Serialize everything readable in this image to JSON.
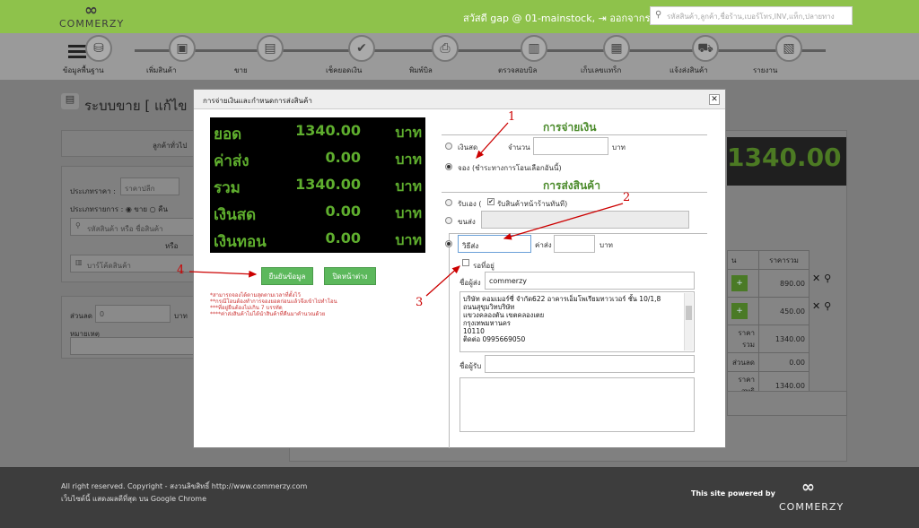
{
  "header": {
    "logo_text": "COMMERZY",
    "greeting": "สวัสดี gap @ 01-mainstock,",
    "logout": "ออกจากระบบ",
    "search_placeholder": "รหัสสินค้า,ลูกค้า,ชื่อร้าน,เบอร์โทร,INV,แท็ก,ปลายทาง"
  },
  "nav": {
    "items": [
      {
        "label": "ข้อมูลพื้นฐาน",
        "icon": "database-icon",
        "glyph": "⛁"
      },
      {
        "label": "เพิ่มสินค้า",
        "icon": "box-icon",
        "glyph": "▣"
      },
      {
        "label": "ขาย",
        "icon": "register-icon",
        "glyph": "▤"
      },
      {
        "label": "เช็คยอดเงิน",
        "icon": "check-icon",
        "glyph": "✔"
      },
      {
        "label": "พิมพ์บิล",
        "icon": "printer-icon",
        "glyph": "⎙"
      },
      {
        "label": "ตรวจสอบบิล",
        "icon": "scanner-icon",
        "glyph": "▥"
      },
      {
        "label": "เก็บเลขแทร็ก",
        "icon": "tracking-icon",
        "glyph": "▦"
      },
      {
        "label": "แจ้งส่งสินค้า",
        "icon": "truck-icon",
        "glyph": "⛟"
      },
      {
        "label": "รายงาน",
        "icon": "report-icon",
        "glyph": "▧"
      }
    ]
  },
  "page": {
    "title": "ระบบขาย [ แก้ไข",
    "customer": "ลูกค้าทั่วไป",
    "price_type_label": "ประเภทราคา :",
    "price_type": "ราคาปลีก",
    "trans_type_label": "ประเภทรายการ :",
    "trans_sell": "ขาย",
    "trans_return": "คืน",
    "product_search_placeholder": "รหัสสินค้า หรือ ชื่อสินค้า",
    "or": "หรือ",
    "barcode_placeholder": "บาร์โค้ดสินค้า",
    "discount_label": "ส่วนลด",
    "discount_value": "0",
    "discount_unit": "บาท",
    "remark_label": "หมายเหตุ",
    "big_total": "1340.00",
    "table_header": "ราคารวม",
    "table_header_left": "น",
    "rows": [
      "890.00",
      "450.00"
    ],
    "summary_rows": [
      {
        "label": "ราคารวม",
        "value": "1340.00"
      },
      {
        "label": "ส่วนลด",
        "value": "0.00"
      },
      {
        "label": "ราคาสุทธิ",
        "value": "1340.00"
      }
    ]
  },
  "modal": {
    "title": "การจ่ายเงินและกำหนดการส่งสินค้า",
    "summary": [
      {
        "label": "ยอด",
        "value": "1340.00",
        "unit": "บาท"
      },
      {
        "label": "ค่าส่ง",
        "value": "0.00",
        "unit": "บาท"
      },
      {
        "label": "รวม",
        "value": "1340.00",
        "unit": "บาท"
      },
      {
        "label": "เงินสด",
        "value": "0.00",
        "unit": "บาท"
      },
      {
        "label": "เงินทอน",
        "value": "0.00",
        "unit": "บาท"
      }
    ],
    "confirm_button": "ยืนยันข้อมูล",
    "close_button": "ปิดหน้าต่าง",
    "notes": [
      "*สามารถจองได้ตามสุดตามเวลาที่ตั้งไว้",
      "**กรณีโอนต้องทำการจองยอดก่อนแล้วจึงเข้าไปทำโอน",
      "***ที่อยู่ยืนต้องไม่เกิน 7 บรรทัด",
      "****ค่าส่งสินค้าไม่ได้นำสินค้าที่คืนมาคำนวณด้วย"
    ],
    "payment_header": "การจ่ายเงิน",
    "pay_cash": "เงินสด",
    "amount_label": "จำนวน",
    "amount_unit": "บาท",
    "pay_reserve": "จอง (ชำระทางการโอนเลือกอันนี้)",
    "shipping_header": "การส่งสินค้า",
    "ship_self": "รับเอง (",
    "ship_self_check": "รับสินค้าหน้าร้านทันที)",
    "ship_carrier": "ขนส่ง",
    "ship_method": "วิธีส่ง",
    "fee_label": "ค่าส่ง",
    "fee_unit": "บาท",
    "wait_address": "รอที่อยู่",
    "sender_label": "ชื่อผู้ส่ง",
    "sender_value": "commerzy",
    "address_lines": [
      "บริษัท คอมเมอร์ซี่ จำกัด622 อาคารเอ็มโพเรียมทาวเวอร์ ชั้น 10/1,8",
      "ถนนสุขุมวิทบริษัท",
      "แขวงคลองตัน เขตคลองเตย",
      "กรุงเทพมหานคร",
      "10110",
      "ติดต่อ 0995669050"
    ],
    "receiver_label": "ชื่อผู้รับ"
  },
  "annotations": [
    "1",
    "2",
    "3",
    "4"
  ],
  "footer": {
    "copyright": "All right reserved. Copyright - สงวนลิขสิทธิ์ http://www.commerzy.com",
    "browser": "เว็บไซต์นี้ แสดงผลดีที่สุด บน Google Chrome",
    "powered": "This site powered by",
    "brand": "COMMERZY"
  },
  "colors": {
    "green": "#8ec24b",
    "annotation": "#cc0000",
    "button": "#5cb85c"
  }
}
